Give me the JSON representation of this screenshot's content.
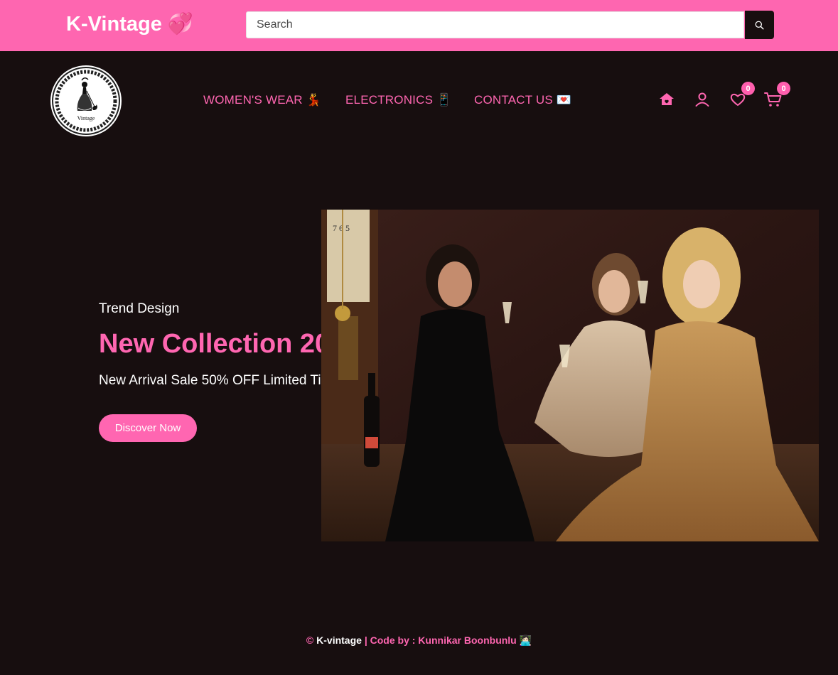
{
  "header": {
    "brand": "K-Vintage",
    "brand_emoji": "💞",
    "search_placeholder": "Search"
  },
  "logo": {
    "text": "Vintage"
  },
  "nav": {
    "items": [
      {
        "label": "WOMEN'S WEAR 💃"
      },
      {
        "label": "ELECTRONICS 📱"
      },
      {
        "label": "CONTACT US 💌"
      }
    ]
  },
  "actions": {
    "icons": [
      "home-icon",
      "user-icon",
      "heart-icon",
      "cart-icon"
    ],
    "wishlist_count": "0",
    "cart_count": "0"
  },
  "hero": {
    "subtitle": "Trend Design",
    "title": "New Collection 20",
    "description": "New Arrival Sale 50% OFF Limited Ti",
    "button_label": "Discover Now"
  },
  "footer": {
    "copyright": "©",
    "brand": "K-vintage",
    "separator": " | ",
    "credit": "Code by : Kunnikar Boonbunlu",
    "credit_emoji": "👩🏻‍💻"
  },
  "colors": {
    "accent": "#fe66b0",
    "background": "#170e0f",
    "white": "#ffffff"
  }
}
